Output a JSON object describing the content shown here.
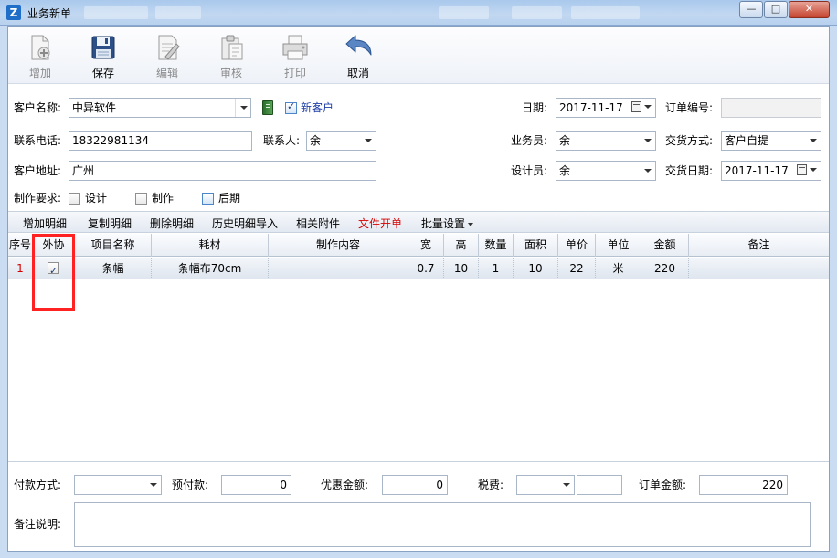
{
  "window": {
    "title": "业务新单",
    "icon_letter": "Z",
    "controls": {
      "minimize": "—",
      "maximize": "□",
      "close": "✕"
    }
  },
  "toolbar": {
    "add": "增加",
    "save": "保存",
    "edit": "编辑",
    "review": "审核",
    "print": "打印",
    "cancel": "取消"
  },
  "form": {
    "customer_name_label": "客户名称:",
    "customer_name": "中异软件",
    "new_customer_label": "新客户",
    "new_customer_checked": true,
    "date_label": "日期:",
    "date": "2017-11-17",
    "order_no_label": "订单编号:",
    "order_no": "",
    "phone_label": "联系电话:",
    "phone": "18322981134",
    "contact_label": "联系人:",
    "contact": "余",
    "salesperson_label": "业务员:",
    "salesperson": "余",
    "delivery_method_label": "交货方式:",
    "delivery_method": "客户自提",
    "address_label": "客户地址:",
    "address": "广州",
    "designer_label": "设计员:",
    "designer": "余",
    "delivery_date_label": "交货日期:",
    "delivery_date": "2017-11-17",
    "requirements_label": "制作要求:",
    "req_design": "设计",
    "req_make": "制作",
    "req_post": "后期"
  },
  "detail_toolbar": {
    "add_detail": "增加明细",
    "copy_detail": "复制明细",
    "delete_detail": "删除明细",
    "history_import": "历史明细导入",
    "attachments": "相关附件",
    "file_order": "文件开单",
    "batch_settings": "批量设置"
  },
  "grid": {
    "columns": [
      "序号",
      "外协",
      "项目名称",
      "耗材",
      "制作内容",
      "宽",
      "高",
      "数量",
      "面积",
      "单价",
      "单位",
      "金额",
      "备注"
    ],
    "rows": [
      {
        "no": "1",
        "outsourced": true,
        "item": "条幅",
        "material": "条幅布70cm",
        "content": "",
        "width": "0.7",
        "height": "10",
        "qty": "1",
        "area": "10",
        "price": "22",
        "unit": "米",
        "amount": "220",
        "note": ""
      }
    ]
  },
  "footer": {
    "payment_method_label": "付款方式:",
    "payment_method": "",
    "prepaid_label": "预付款:",
    "prepaid": "0",
    "discount_label": "优惠金额:",
    "discount": "0",
    "tax_label": "税费:",
    "tax_type": "",
    "tax_value": "",
    "order_amount_label": "订单金额:",
    "order_amount": "220",
    "memo_label": "备注说明:",
    "memo": ""
  },
  "colors": {
    "accent_red": "#d40000",
    "highlight_box": "#ff2222",
    "link_blue": "#1f3fa8"
  }
}
